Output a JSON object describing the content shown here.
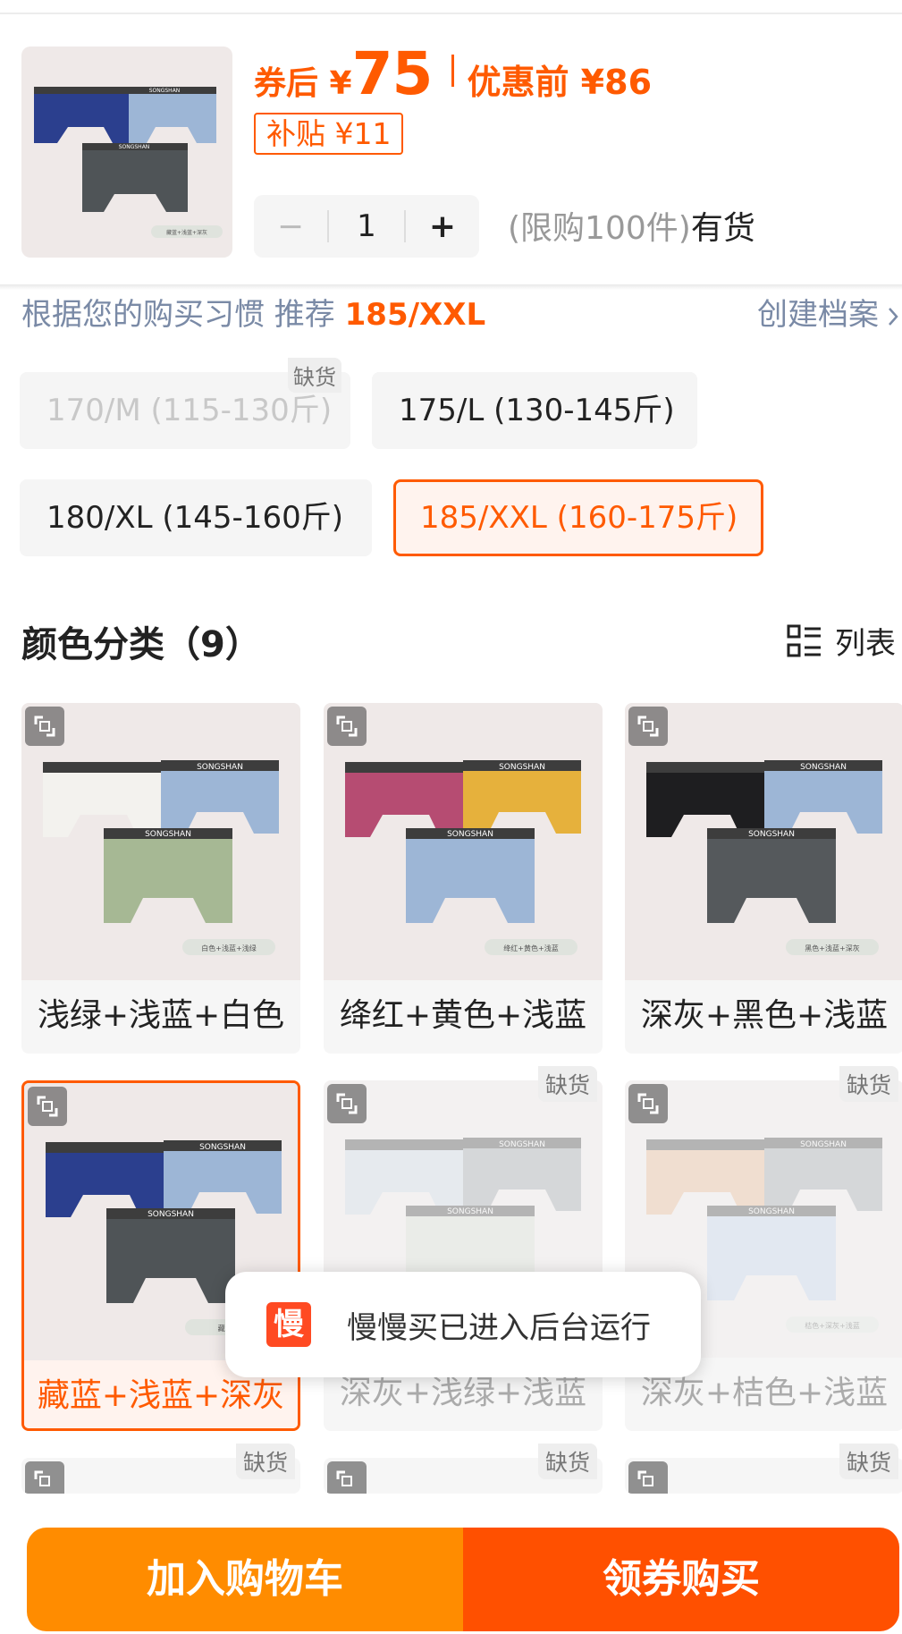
{
  "product": {
    "price_label": "券后 ¥",
    "price_value": "75",
    "original_label": "优惠前 ¥86",
    "subsidy": "补贴 ¥11",
    "quantity": "1",
    "minus": "−",
    "plus": "+",
    "limit_text": "(限购100件)",
    "stock_text": "有货",
    "thumb_caption": "藏蓝+浅蓝+深灰"
  },
  "recommendation": {
    "prefix": "根据您的购买习惯 推荐 ",
    "size": "185/XXL",
    "create_link": "创建档案"
  },
  "sizes": [
    {
      "label": "170/M (115-130斤)",
      "state": "disabled",
      "tag": "缺货"
    },
    {
      "label": "175/L (130-145斤)",
      "state": "normal"
    },
    {
      "label": "180/XL (145-160斤)",
      "state": "normal"
    },
    {
      "label": "185/XXL (160-175斤)",
      "state": "selected"
    }
  ],
  "colors": {
    "title": "颜色分类（9）",
    "list_label": "列表",
    "oos_tag": "缺货",
    "items": [
      {
        "name": "浅绿+浅蓝+白色",
        "caption": "白色+浅蓝+浅绿"
      },
      {
        "name": "绛红+黄色+浅蓝",
        "caption": "绛红+黄色+浅蓝"
      },
      {
        "name": "深灰+黑色+浅蓝",
        "caption": "黑色+浅蓝+深灰"
      },
      {
        "name": "藏蓝+浅蓝+深灰",
        "caption": "藏蓝+浅"
      },
      {
        "name": "深灰+浅绿+浅蓝",
        "caption": ""
      },
      {
        "name": "深灰+桔色+浅蓝",
        "caption": "桔色+深灰+浅蓝"
      }
    ]
  },
  "brand_text": "SONGSHAN",
  "toast": {
    "logo": "慢",
    "message": "慢慢买已进入后台运行"
  },
  "actions": {
    "cart": "加入购物车",
    "buy": "领券购买"
  },
  "colors_hex": {
    "accent": "#ff5a00",
    "cart": "#ff8c00",
    "buy": "#ff5000"
  }
}
